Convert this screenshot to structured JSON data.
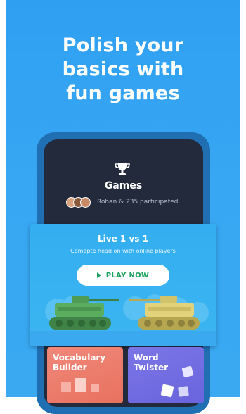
{
  "headline": {
    "lines": [
      "Polish your",
      "basics with",
      "fun games"
    ]
  },
  "games_panel": {
    "title": "Games",
    "participants_text": "Rohan & 235 participated"
  },
  "live_card": {
    "title": "Live 1 vs 1",
    "subtitle": "Comepte head on with online players",
    "play_label": "PLAY NOW"
  },
  "game_cards": [
    {
      "label_line1": "Vocabulary",
      "label_line2": "Builder"
    },
    {
      "label_line1": "Word",
      "label_line2": "Twister"
    }
  ],
  "colors": {
    "background": "#37a7f3",
    "phone_screen": "#222a3c",
    "play_text": "#1aa15d",
    "vocab_card": "#ec7b6b",
    "twister_card": "#716ce1"
  },
  "icons": [
    "trophy-icon",
    "play-icon",
    "avatar"
  ]
}
